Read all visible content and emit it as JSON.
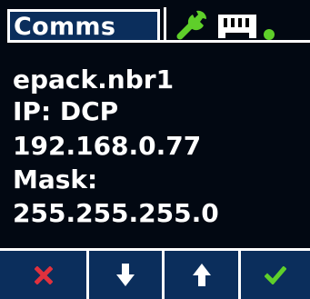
{
  "header": {
    "tab_title": "Comms",
    "icons": [
      "wrench-icon",
      "ethernet-port-icon",
      "link-status-dot"
    ]
  },
  "info": {
    "hostname": "epack.nbr1",
    "ip_mode": "IP: DCP",
    "ip_address": "192.168.0.77",
    "mask_label": "Mask:",
    "mask_value": "255.255.255.0"
  },
  "buttons": [
    {
      "name": "cancel-button",
      "icon": "x-icon"
    },
    {
      "name": "down-button",
      "icon": "arrow-down-icon"
    },
    {
      "name": "up-button",
      "icon": "arrow-up-icon"
    },
    {
      "name": "confirm-button",
      "icon": "check-icon"
    }
  ],
  "colors": {
    "panel": "#0b2e5c",
    "text": "#ffffff",
    "cancel": "#e0313d",
    "confirm": "#5fcf2a",
    "wrench": "#5fcf2a"
  }
}
